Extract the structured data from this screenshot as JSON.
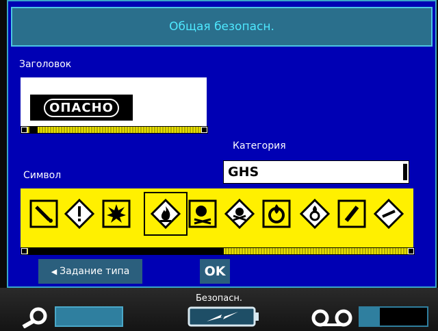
{
  "dialog": {
    "title": "Общая безопасн.",
    "header_label": "Заголовок",
    "preview_text": "ОПАСНО",
    "category_label": "Категория",
    "category_value": "GHS",
    "symbol_label": "Символ",
    "symbols": [
      "pictogram-1",
      "pictogram-2",
      "pictogram-3",
      "pictogram-4",
      "pictogram-5",
      "pictogram-6",
      "pictogram-7",
      "pictogram-8",
      "pictogram-9",
      "pictogram-10"
    ],
    "selected_symbol_index": 3,
    "back_button_label": "Задание типа",
    "ok_button_label": "OK"
  },
  "status_bar": {
    "text": "Безопасн.",
    "tape_level": 0.3
  },
  "colors": {
    "background": "#0000b4",
    "title_bg": "#2a6f8c",
    "title_text": "#4ee8ff",
    "symbol_strip": "#fff000",
    "button_bg": "#2b5f7d"
  }
}
